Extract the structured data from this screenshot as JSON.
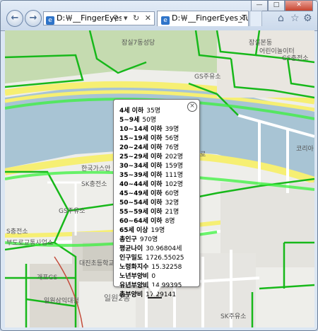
{
  "browser": {
    "nav": {
      "back_symbol": "←",
      "forward_symbol": "→"
    },
    "address": {
      "text": "D:￦__FingerEyes_Tu",
      "controls": "⚲ ▾ ↻ ✕"
    },
    "tab": {
      "label": "D:￦__FingerEyes_Tutori...",
      "close": "×"
    },
    "toolbar": {
      "home_symbol": "⌂",
      "star_symbol": "☆",
      "gear_symbol": "⚙"
    },
    "window": {
      "min": "—",
      "max": "□",
      "close": "✕"
    }
  },
  "map_labels": {
    "l1": "잠실7동성당",
    "l2": "잠실본동",
    "l3": "어린이놀이터",
    "l4": "GS충전소",
    "l5": "GS주유소",
    "l6": "코리아",
    "l7": "한국가스안",
    "l8": "SK충전소",
    "l9": "GS주유소",
    "l10": "S충전소",
    "l11": "부도로교통사업소",
    "l12": "대진초등학교",
    "l13": "개포GS",
    "l14": "일원삼익대청",
    "l15": "일원2동",
    "l16": "SK주유소",
    "l17": "로"
  },
  "popup": {
    "close": "×",
    "rows": [
      {
        "label": "4세 이하",
        "value": "35명"
      },
      {
        "label": "5~9세",
        "value": "50명"
      },
      {
        "label": "10~14세 이하",
        "value": "39명"
      },
      {
        "label": "15~19세 이하",
        "value": "56명"
      },
      {
        "label": "20~24세 이하",
        "value": "76명"
      },
      {
        "label": "25~29세 이하",
        "value": "202명"
      },
      {
        "label": "30~34세 이하",
        "value": "159명"
      },
      {
        "label": "35~39세 이하",
        "value": "111명"
      },
      {
        "label": "40~44세 이하",
        "value": "102명"
      },
      {
        "label": "45~49세 이하",
        "value": "60명"
      },
      {
        "label": "50~54세 이하",
        "value": "32명"
      },
      {
        "label": "55~59세 이하",
        "value": "21명"
      },
      {
        "label": "60~64세 이하",
        "value": "8명"
      },
      {
        "label": "65세 이상",
        "value": "19명"
      },
      {
        "label": "총인구",
        "value": "970명"
      },
      {
        "label": "평균나이",
        "value": "30.96804세"
      },
      {
        "label": "인구밀도",
        "value": "1726.55025"
      },
      {
        "label": "노령화지수",
        "value": "15.32258"
      },
      {
        "label": "노년부양비",
        "value": "0"
      },
      {
        "label": "유년부양비",
        "value": "14.99395"
      },
      {
        "label": "총부양비",
        "value": "17.29141"
      }
    ]
  },
  "colors": {
    "boundary": "#17b81a",
    "river": "#a8c4d4",
    "park": "#c5dbb0",
    "road_yellow": "#f6ef73"
  }
}
